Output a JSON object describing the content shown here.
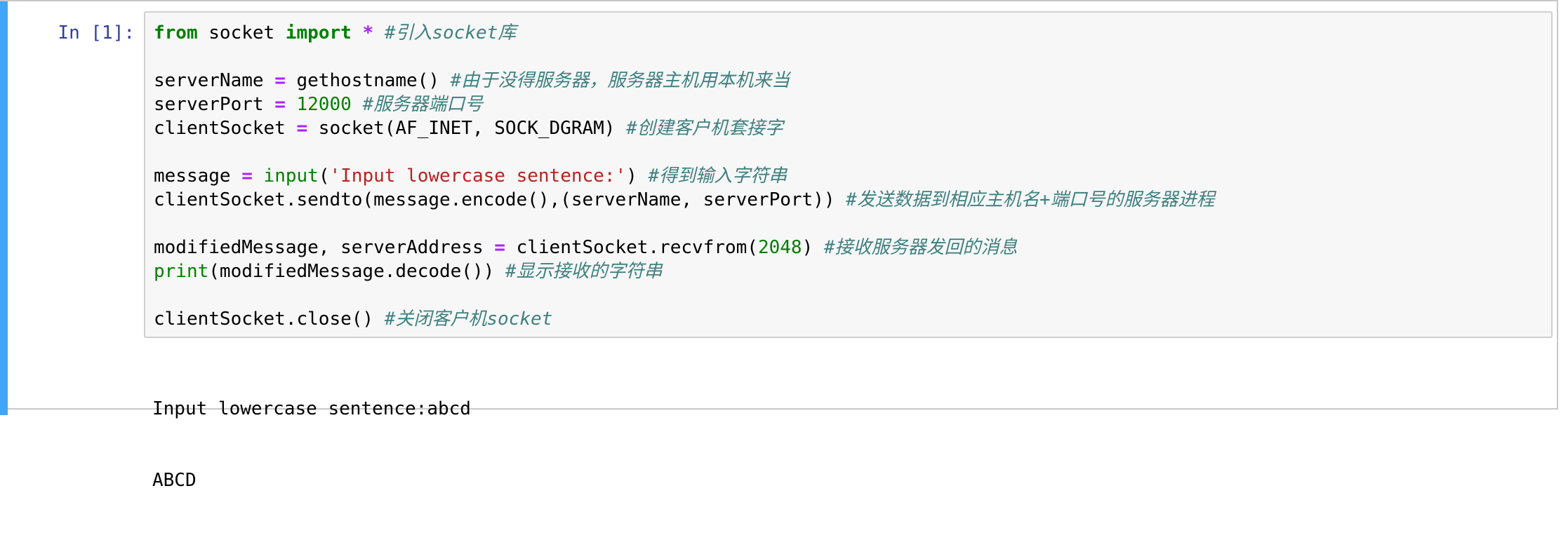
{
  "cell": {
    "prompt": "In [1]:",
    "code": {
      "line1": {
        "kw_from": "from",
        "mod": " socket ",
        "kw_import": "import",
        "space": " ",
        "star": "*",
        "space2": " ",
        "comment": "#引入socket库"
      },
      "line3": {
        "name": "serverName ",
        "eq": "=",
        "call": " gethostname() ",
        "comment": "#由于没得服务器，服务器主机用本机来当"
      },
      "line4": {
        "name": "serverPort ",
        "eq": "=",
        "space": " ",
        "num": "12000",
        "space2": " ",
        "comment": "#服务器端口号"
      },
      "line5": {
        "name": "clientSocket ",
        "eq": "=",
        "call": " socket(AF_INET, SOCK_DGRAM) ",
        "comment": "#创建客户机套接字"
      },
      "line7": {
        "name": "message ",
        "eq": "=",
        "space": " ",
        "builtin": "input",
        "open": "(",
        "str": "'Input lowercase sentence:'",
        "close": ") ",
        "comment": "#得到输入字符串"
      },
      "line8": {
        "call": "clientSocket.sendto(message.encode(),(serverName, serverPort)) ",
        "comment": "#发送数据到相应主机名+端口号的服务器进程"
      },
      "line10": {
        "name": "modifiedMessage, serverAddress ",
        "eq": "=",
        "call": " clientSocket.recvfrom(",
        "num": "2048",
        "close": ") ",
        "comment": "#接收服务器发回的消息"
      },
      "line11": {
        "builtin": "print",
        "call": "(modifiedMessage.decode()) ",
        "comment": "#显示接收的字符串"
      },
      "line13": {
        "call": "clientSocket.close() ",
        "comment": "#关闭客户机socket"
      }
    },
    "output": [
      "Input lowercase sentence:abcd",
      "ABCD"
    ]
  },
  "colors": {
    "selected_bar": "#42a5f5",
    "prompt": "#303f9f",
    "keyword": "#008000",
    "operator": "#aa22ff",
    "string": "#ba2121",
    "comment": "#408080"
  }
}
